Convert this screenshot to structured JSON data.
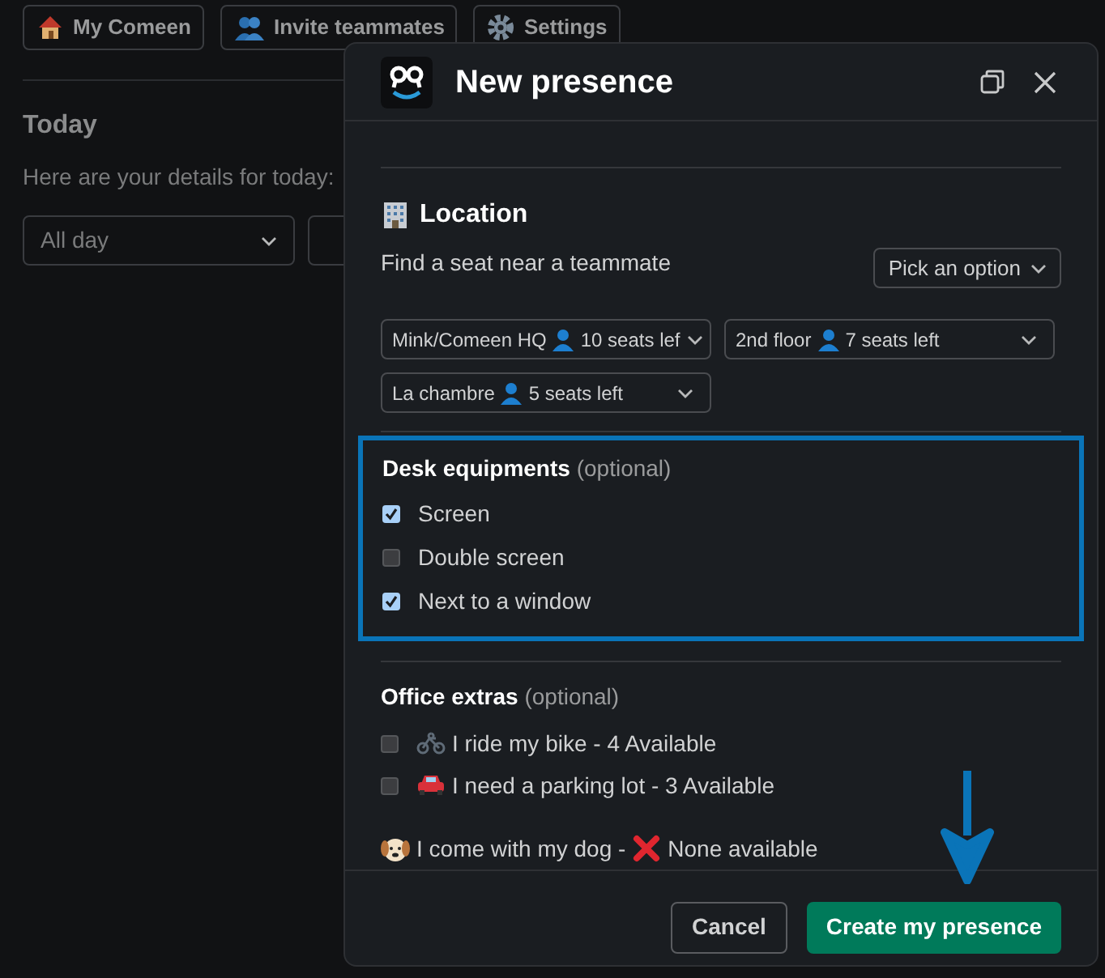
{
  "top_tabs": [
    {
      "label": "My Comeen"
    },
    {
      "label": "Invite teammates"
    },
    {
      "label": "Settings"
    }
  ],
  "today": {
    "title": "Today",
    "subtitle": "Here are your details for today:",
    "time_select": "All day"
  },
  "modal": {
    "title": "New presence",
    "location": {
      "title": "Location",
      "prompt": "Find a seat near a teammate",
      "pick_button": "Pick an option",
      "selects": [
        {
          "place": "Mink/Comeen HQ",
          "seats": "10 seats lef"
        },
        {
          "place": "2nd floor",
          "seats": "7 seats left"
        },
        {
          "place": "La chambre",
          "seats": "5 seats left"
        }
      ]
    },
    "desk_equipments": {
      "title": "Desk equipments",
      "note": "(optional)",
      "highlighted": true,
      "items": [
        {
          "label": "Screen",
          "checked": true
        },
        {
          "label": "Double screen",
          "checked": false
        },
        {
          "label": "Next to a window",
          "checked": true
        }
      ]
    },
    "office_extras": {
      "title": "Office extras",
      "note": "(optional)",
      "items": [
        {
          "kind": "checkbox",
          "label": "I ride my bike - 4 Available",
          "checked": false
        },
        {
          "kind": "checkbox",
          "label": "I need a parking lot - 3 Available",
          "checked": false
        },
        {
          "kind": "info",
          "label": "I come with my dog -",
          "status": "None available"
        }
      ]
    },
    "buttons": [
      {
        "label": "Cancel",
        "kind": "secondary"
      },
      {
        "label": "Create my presence",
        "kind": "primary"
      }
    ]
  }
}
